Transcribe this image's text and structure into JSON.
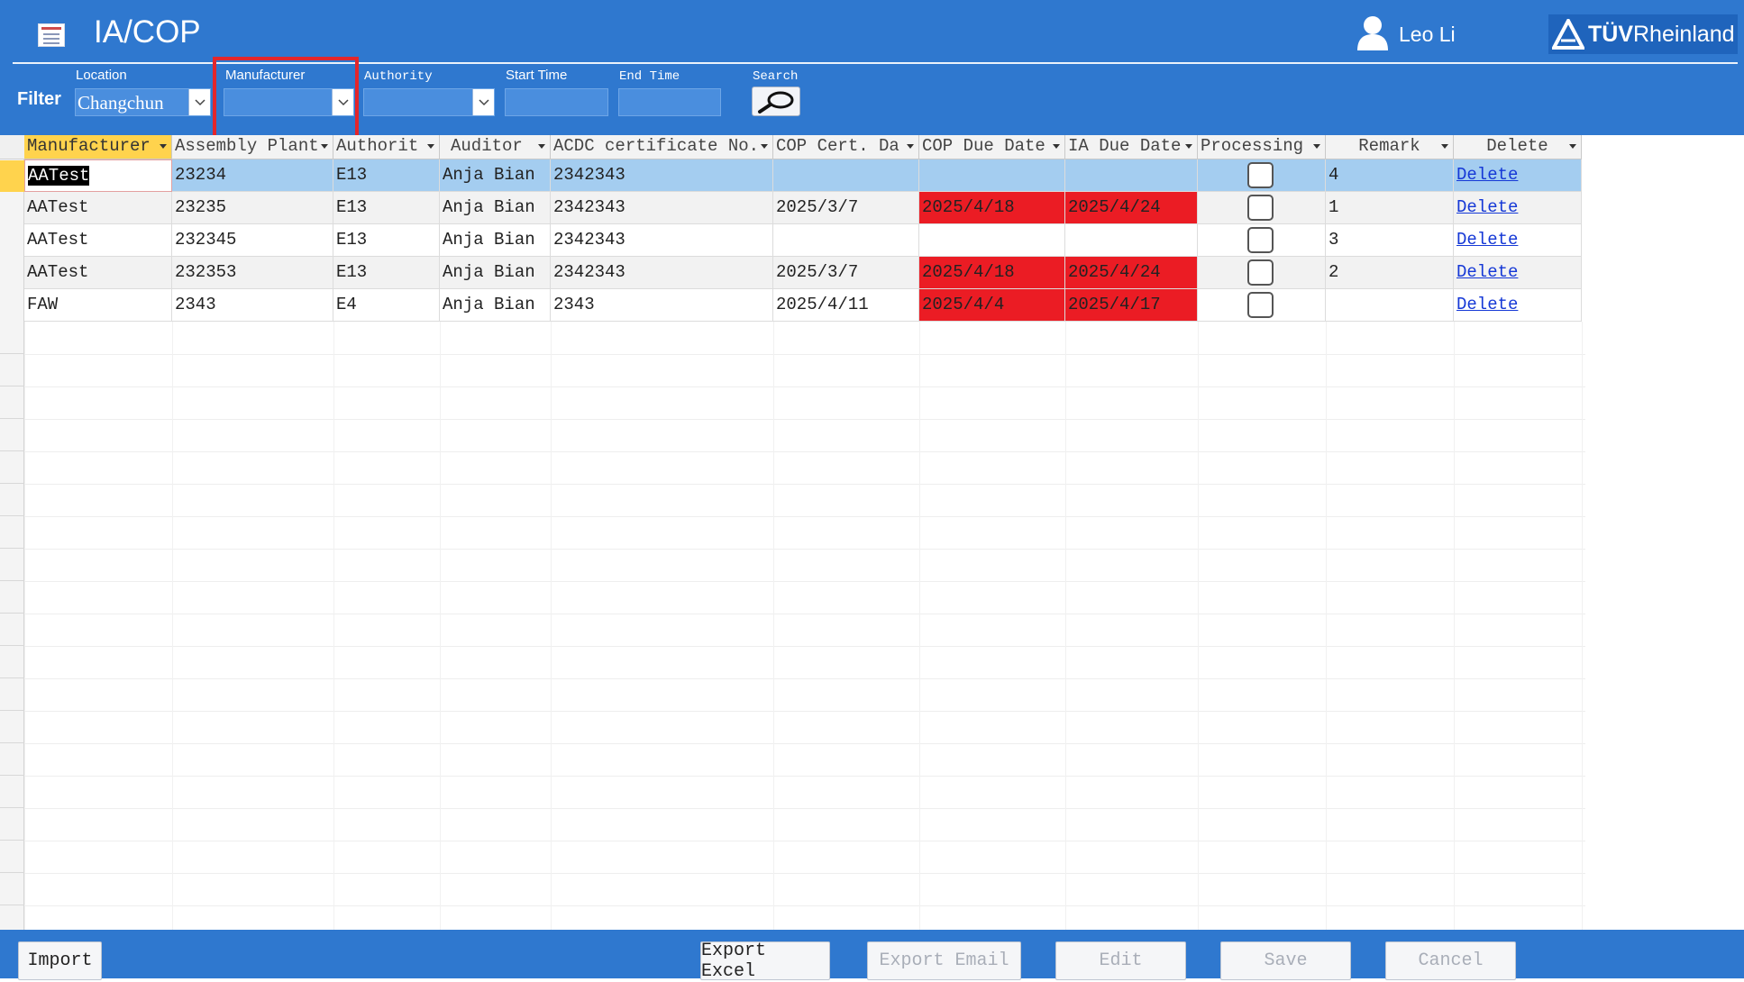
{
  "header": {
    "title": "IA/COP",
    "user_name": "Leo Li",
    "brand_text": "TÜV",
    "brand_text2": "Rheinland"
  },
  "filter": {
    "label": "Filter",
    "location": {
      "label": "Location",
      "value": "Changchun"
    },
    "manufacturer": {
      "label": "Manufacturer",
      "value": ""
    },
    "authority": {
      "label": "Authority",
      "value": ""
    },
    "start_time": {
      "label": "Start Time",
      "value": ""
    },
    "end_time": {
      "label": "End Time",
      "value": ""
    },
    "search": {
      "label": "Search"
    }
  },
  "table": {
    "columns": [
      "Manufacturer",
      "Assembly Plant",
      "Authorit",
      "Auditor",
      "ACDC certificate No.",
      "COP Cert. Da",
      "COP Due Date",
      "IA Due Date",
      "Processing",
      "Remark",
      "Delete"
    ],
    "rows": [
      {
        "manufacturer": "AATest",
        "plant": "23234",
        "authority": "E13",
        "auditor": "Anja Bian",
        "acdc": "2342343",
        "cop_cert": "",
        "cop_due": "",
        "ia_due": "",
        "remark": "4",
        "delete": "Delete"
      },
      {
        "manufacturer": "AATest",
        "plant": "23235",
        "authority": "E13",
        "auditor": "Anja Bian",
        "acdc": "2342343",
        "cop_cert": "2025/3/7",
        "cop_due": "2025/4/18",
        "ia_due": "2025/4/24",
        "remark": "1",
        "delete": "Delete"
      },
      {
        "manufacturer": "AATest",
        "plant": "232345",
        "authority": "E13",
        "auditor": "Anja Bian",
        "acdc": "2342343",
        "cop_cert": "",
        "cop_due": "",
        "ia_due": "",
        "remark": "3",
        "delete": "Delete"
      },
      {
        "manufacturer": "AATest",
        "plant": "232353",
        "authority": "E13",
        "auditor": "Anja Bian",
        "acdc": "2342343",
        "cop_cert": "2025/3/7",
        "cop_due": "2025/4/18",
        "ia_due": "2025/4/24",
        "remark": "2",
        "delete": "Delete"
      },
      {
        "manufacturer": "FAW",
        "plant": "2343",
        "authority": "E4",
        "auditor": "Anja Bian",
        "acdc": "2343",
        "cop_cert": "2025/4/11",
        "cop_due": "2025/4/4",
        "ia_due": "2025/4/17",
        "remark": "",
        "delete": "Delete"
      }
    ]
  },
  "footer": {
    "import": "Import",
    "export_excel": "Export Excel",
    "export_email": "Export Email",
    "edit": "Edit",
    "save": "Save",
    "cancel": "Cancel"
  },
  "colors": {
    "header_blue": "#2f78cf",
    "overdue_red": "#eb1c24",
    "selected_row": "#a4cdf0",
    "alt_row": "#f2f2f2",
    "highlight_box": "#e3262b"
  }
}
